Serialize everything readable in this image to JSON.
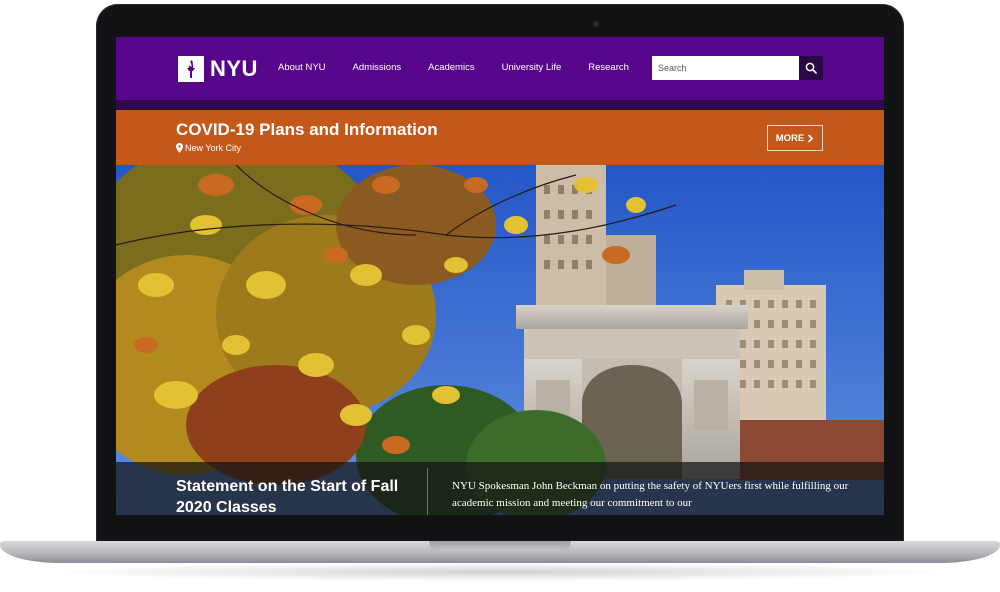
{
  "header": {
    "logo_text": "NYU",
    "nav": [
      "About NYU",
      "Admissions",
      "Academics",
      "University Life",
      "Research"
    ],
    "search_placeholder": "Search"
  },
  "banner": {
    "title": "COVID-19 Plans and Information",
    "location": "New York City",
    "more_label": "MORE"
  },
  "hero": {
    "headline": "Statement on the Start of Fall 2020 Classes",
    "summary": "NYU Spokesman John Beckman on putting the safety of NYUers first while fulfilling our academic mission and meeting our commitment to our"
  },
  "colors": {
    "brand_purple": "#57068c",
    "banner_orange": "#c4581b"
  },
  "icons": [
    "nyu-torch-icon",
    "search-icon",
    "location-pin-icon",
    "chevron-right-icon"
  ]
}
